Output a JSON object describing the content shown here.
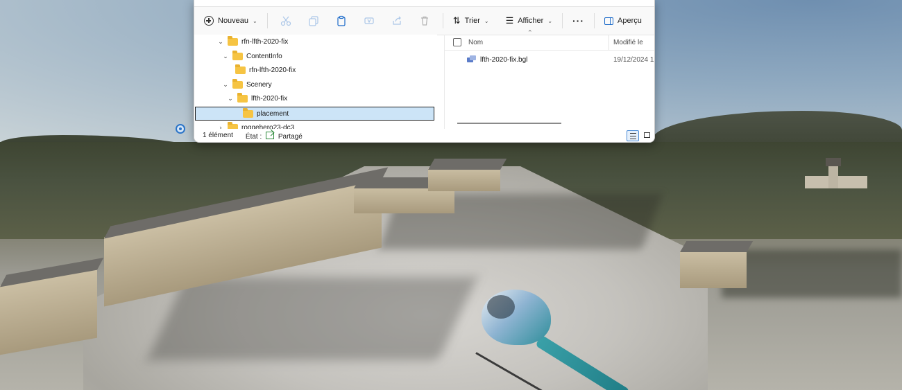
{
  "toolbar": {
    "new_label": "Nouveau",
    "sort_label": "Trier",
    "view_label": "Afficher",
    "more_label": "···",
    "preview_label": "Aperçu"
  },
  "tree": {
    "items": [
      {
        "label": "rfn-lfth-2020-fix",
        "chevron": "⌄"
      },
      {
        "label": "ContentInfo",
        "chevron": "⌄"
      },
      {
        "label": "rfn-lfth-2020-fix",
        "chevron": ""
      },
      {
        "label": "Scenery",
        "chevron": "⌄"
      },
      {
        "label": "lfth-2020-fix",
        "chevron": "⌄"
      },
      {
        "label": "placement",
        "chevron": ""
      },
      {
        "label": "roggehero23-dc3",
        "chevron": "›"
      }
    ]
  },
  "columns": {
    "name": "Nom",
    "modified": "Modifié le"
  },
  "files": [
    {
      "name": "lfth-2020-fix.bgl",
      "modified": "19/12/2024 1"
    }
  ],
  "status": {
    "count": "1 élément",
    "state_label": "État :",
    "state_value": "Partagé"
  },
  "colors": {
    "selection_bg": "#cce4f7",
    "folder": "#f6c443",
    "share_green": "#2c8a3a"
  }
}
